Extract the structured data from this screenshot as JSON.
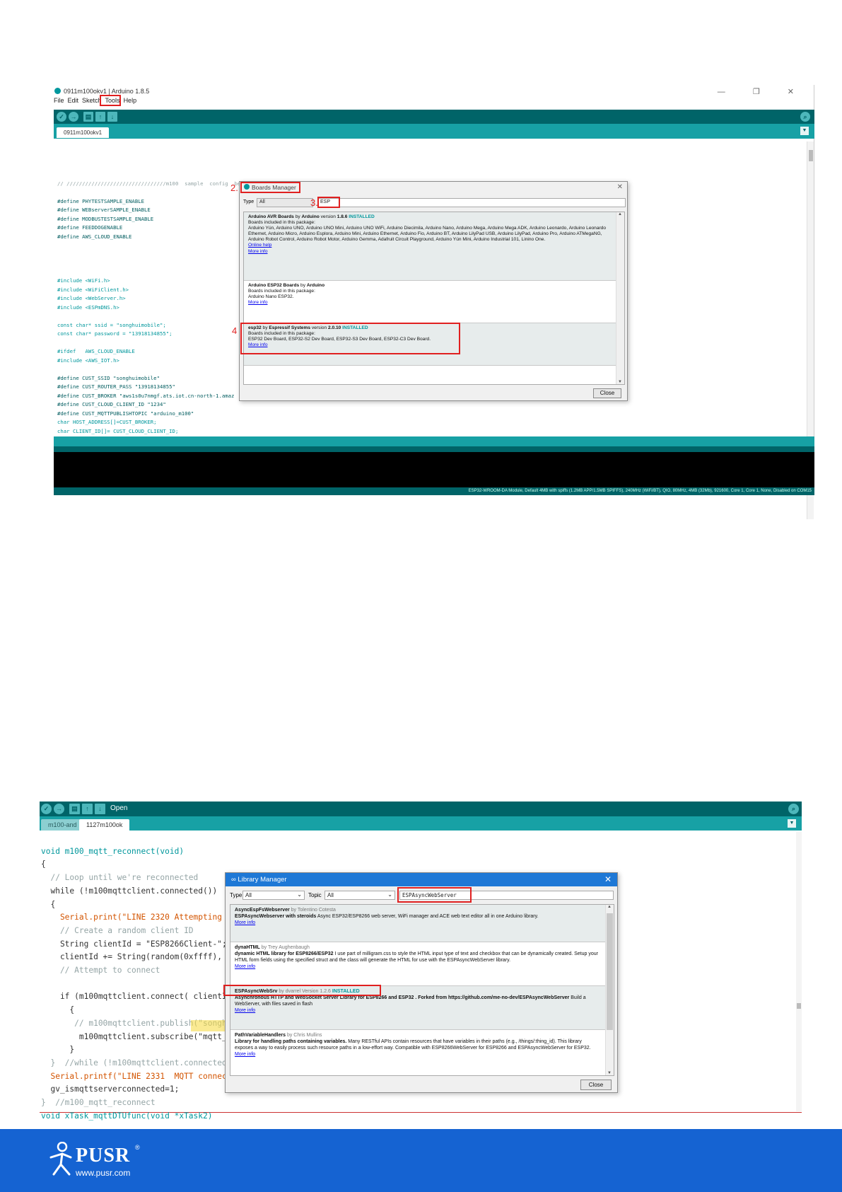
{
  "shot1": {
    "window_title": "0911m100okv1 | Arduino 1.8.5",
    "window_controls": "—  ❐  ✕",
    "menu": [
      "File",
      "Edit",
      "Sketch",
      "Tools",
      "Help"
    ],
    "tab": "0911m100okv1",
    "code_lines": [
      "// ////////////////////////////////m100  sample  config  begin/////////////////////////////////////////",
      "",
      "#define PHYTESTSAMPLE_ENABLE",
      "#define WEBserverSAMPLE_ENABLE",
      "#define MODBUSTESTSAMPLE_ENABLE",
      "#define FEEDDOGENABLE",
      "#define AWS_CLOUD_ENABLE",
      "",
      "",
      "",
      "",
      "#include <WiFi.h>",
      "#include <WiFiClient.h>",
      "#include <WebServer.h>",
      "#include <ESPmDNS.h>",
      "",
      "const char* ssid = \"songhuimobile\";",
      "const char* password = \"13918134855\";",
      "",
      "#ifdef   AWS_CLOUD_ENABLE",
      "#include <AWS_IOT.h>",
      "",
      "#define CUST_SSID \"songhuimobile\"",
      "#define CUST_ROUTER_PASS \"13918134855\"",
      "#define CUST_BROKER \"aws1s0u7nmgf.ats.iot.cn-north-1.amaz",
      "#define CUST_CLOUD_CLIENT_ID \"1234\"",
      "#define CUST_MQTTPUBLISHTOPIC \"arduino_m100\"",
      "char HOST_ADDRESS[]=CUST_BROKER;",
      "char CLIENT_ID[]= CUST_CLOUD_CLIENT_ID;"
    ],
    "status_text": "ESP32-WROOM-DA Module, Default 4MB with spiffs (1.2MB APP/1.5MB SPIFFS), 240MHz (WiFi/BT), QIO, 80MHz, 4MB (32Mb), 921600, Core 1, Core 1, None, Disabled on COM15",
    "annotations": {
      "n2": "2.",
      "n3": "3.",
      "n4": "4"
    },
    "dialog": {
      "title": "Boards Manager",
      "type_label": "Type",
      "type_value": "All",
      "search": "ESP",
      "close": "Close",
      "entries": [
        {
          "name": "Arduino AVR Boards",
          "by": "by",
          "author": "Arduino",
          "version_label": "version",
          "version": "1.8.6",
          "status": "INSTALLED",
          "included": "Boards included in this package:",
          "boards": "Arduino Yún, Arduino UNO, Arduino UNO Mini, Arduino UNO WiFi, Arduino Diecimila, Arduino Nano, Arduino Mega, Arduino Mega ADK, Arduino Leonardo, Arduino Leonardo Ethernet, Arduino Micro, Arduino Esplora, Arduino Mini, Arduino Ethernet, Arduino Fio, Arduino BT, Arduino LilyPad USB, Arduino LilyPad, Arduino Pro, Arduino ATMegaNG, Arduino Robot Control, Arduino Robot Motor, Arduino Gemma, Adafruit Circuit Playground, Arduino Yún Mini, Arduino Industrial 101, Linino One.",
          "link1": "Online help",
          "link2": "More info"
        },
        {
          "name": "Arduino ESP32 Boards",
          "by": "by",
          "author": "Arduino",
          "included": "Boards included in this package:",
          "boards": "Arduino Nano ESP32.",
          "link2": "More info"
        },
        {
          "name": "esp32",
          "by": "by",
          "author": "Espressif Systems",
          "version_label": "version",
          "version": "2.0.10",
          "status": "INSTALLED",
          "included": "Boards included in this package:",
          "boards": "ESP32 Dev Board, ESP32-S2 Dev Board, ESP32-S3 Dev Board, ESP32-C3 Dev Board.",
          "link2": "More info"
        }
      ]
    }
  },
  "shot2": {
    "open_label": "Open",
    "tabs": [
      "m100-and",
      "1127m100ok"
    ],
    "code_lines": [
      "void m100_mqtt_reconnect(void)",
      "{",
      "  // Loop until we're reconnected",
      "  while (!m100mqttclient.connected())",
      "  {",
      "    Serial.print(\"LINE 2320 Attempting MQT",
      "    // Create a random client ID",
      "    String clientId = \"ESP8266Client-\";",
      "    clientId += String(random(0xffff), HEX",
      "    // Attempt to connect",
      "",
      "    if (m100mqttclient.connect( clientId.c",
      "      {",
      "       // m100mqttclient.publish(\"songhuic",
      "        m100mqttclient.subscribe(\"mqtt_to_",
      "      }",
      "  }  //while (!m100mqttclient.connected())",
      "  Serial.printf(\"LINE 2331  MQTT connecti",
      "  gv_ismqttserverconnected=1;",
      "}  //m100_mqtt_reconnect",
      "void xTask_mqttDTUfunc(void *xTask2)"
    ],
    "dialog": {
      "title": "Library Manager",
      "type_label": "Type",
      "type_value": "All",
      "topic_label": "Topic",
      "topic_value": "All",
      "search": "ESPAsyncWebServer",
      "close": "Close",
      "entries": [
        {
          "name": "AsyncEspFsWebserver",
          "by": "by Tolentino Cotesta",
          "desc_bold": "ESPAsyncWebserver with steroids",
          "desc": " Async ESP32/ESP8266 web server, WiFi manager and ACE web text editor all in one Arduino library.",
          "link": "More info"
        },
        {
          "name": "dynaHTML",
          "by": "by Trey Aughenbaugh",
          "desc_bold": "dynamic HTML library for ESP8266/ESP32",
          "desc": " I use part of milligram.css to style the HTML input type of text and checkbox that can be dynamically created. Setup your HTML form fields using the specified struct and the class will generate the HTML for use with the ESPAsyncWebServer library.",
          "link": "More info"
        },
        {
          "name": "ESPAsyncWebSrv",
          "by": "by dvarrel Version 1.2.6",
          "status": "INSTALLED",
          "desc_bold": "Asynchronous HTTP and WebSocket Server Library for ESP8266 and ESP32 . Forked from https://github.com/me-no-dev/ESPAsyncWebServer",
          "desc": " Build a WebServer, with files saved in flash",
          "link": "More info"
        },
        {
          "name": "PathVariableHandlers",
          "by": "by Chris Mullins",
          "desc_bold": "Library for handling paths containing variables.",
          "desc": " Many RESTful APIs contain resources that have variables in their paths (e.g., /things/:thing_id). This library exposes a way to easily process such resource paths in a low-effort way. Compatible with ESP8266WebServer for ESP8266 and ESPAsyncWebServer for ESP32.",
          "link": "More info"
        }
      ]
    }
  },
  "footer": {
    "brand": "PUSR",
    "reg": "®",
    "url": "www.pusr.com"
  },
  "colors": {
    "arduino_dark": "#006468",
    "arduino_teal": "#17a1a5",
    "footer_blue": "#1563d2",
    "annotation_red": "#e02020"
  }
}
